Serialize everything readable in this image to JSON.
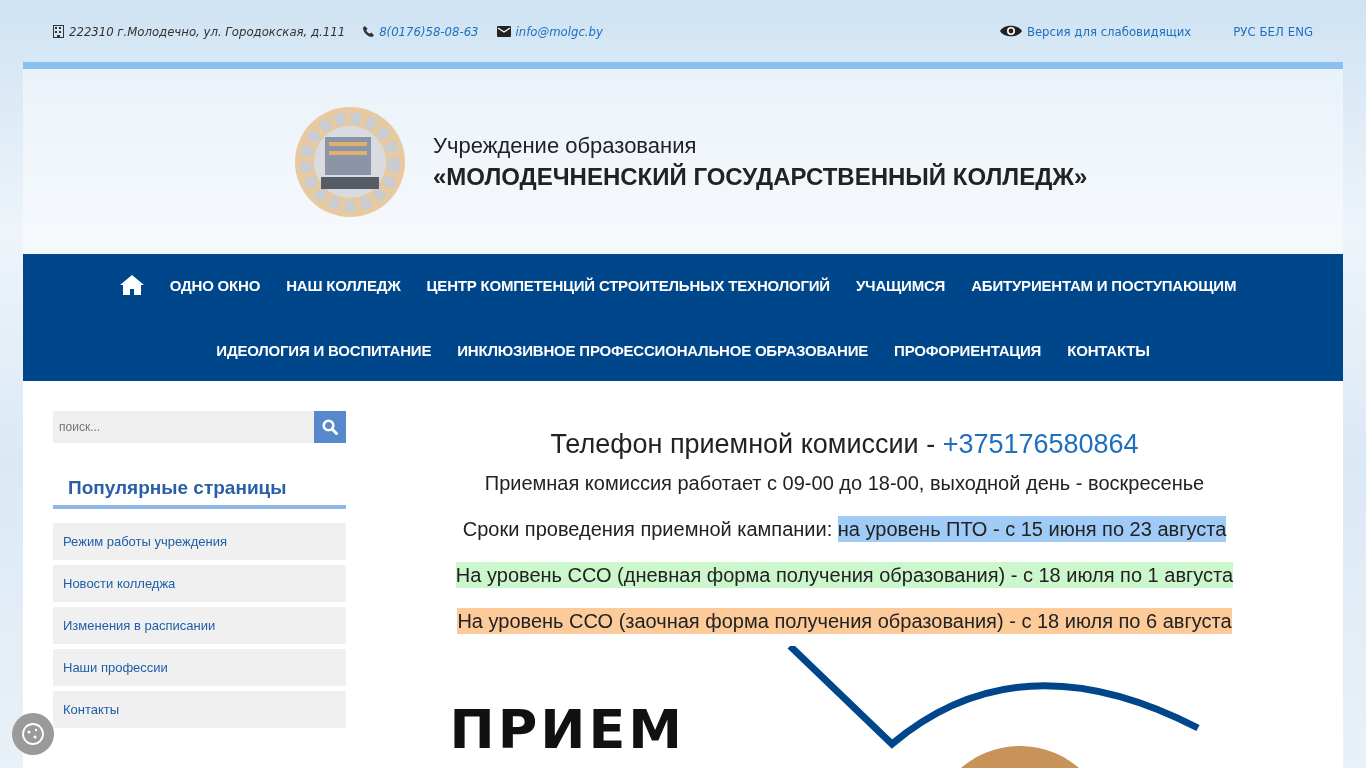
{
  "topbar": {
    "address": "222310 г.Молодечно, ул. Городокская, д.111",
    "phone": "8(0176)58-08-63",
    "email": "info@molgc.by",
    "accessibility": "Версия для слабовидящих",
    "languages": [
      "РУС",
      "БЕЛ",
      "ENG"
    ]
  },
  "header": {
    "subtitle": "Учреждение образования",
    "title": "«МОЛОДЕЧНЕНСКИЙ ГОСУДАРСТВЕННЫЙ КОЛЛЕДЖ»"
  },
  "nav": {
    "items": [
      "ОДНО ОКНО",
      "НАШ КОЛЛЕДЖ",
      "ЦЕНТР КОМПЕТЕНЦИЙ СТРОИТЕЛЬНЫХ ТЕХНОЛОГИЙ",
      "УЧАЩИМСЯ",
      "АБИТУРИЕНТАМ И ПОСТУПАЮЩИМ",
      "ИДЕОЛОГИЯ И ВОСПИТАНИЕ",
      "ИНКЛЮЗИВНОЕ ПРОФЕССИОНАЛЬНОЕ ОБРАЗОВАНИЕ",
      "ПРОФОРИЕНТАЦИЯ",
      "КОНТАКТЫ"
    ]
  },
  "sidebar": {
    "search": {
      "placeholder": "поиск..."
    },
    "heading": "Популярные страницы",
    "items": [
      "Режим работы учреждения",
      "Новости колледжа",
      "Изменения в расписании",
      "Наши профессии",
      "Контакты"
    ]
  },
  "content": {
    "phone_label": "Телефон приемной комиссии - ",
    "phone": "+375176580864",
    "lines": [
      {
        "segments": [
          {
            "text": "Приемная комиссия работает с 09-00 до 18-00, выходной день - воскресенье"
          }
        ]
      },
      {
        "segments": [
          {
            "text": "Сроки проведения приемной кампании: "
          },
          {
            "text": "на уровень ПТО - с 15 июня по 23 августа",
            "color": "#9fcbf6"
          }
        ]
      },
      {
        "segments": [
          {
            "text": "На уровень ССО (дневная форма получения образования) - с 18 июля по 1 августа",
            "color": "#ccf7cc"
          }
        ]
      },
      {
        "segments": [
          {
            "text": "На уровень ССО (заочная форма получения образования) - с 18 июля по 6 августа",
            "color": "#fdcb9a"
          }
        ]
      }
    ],
    "banner_title": "ПРИЕМ"
  }
}
